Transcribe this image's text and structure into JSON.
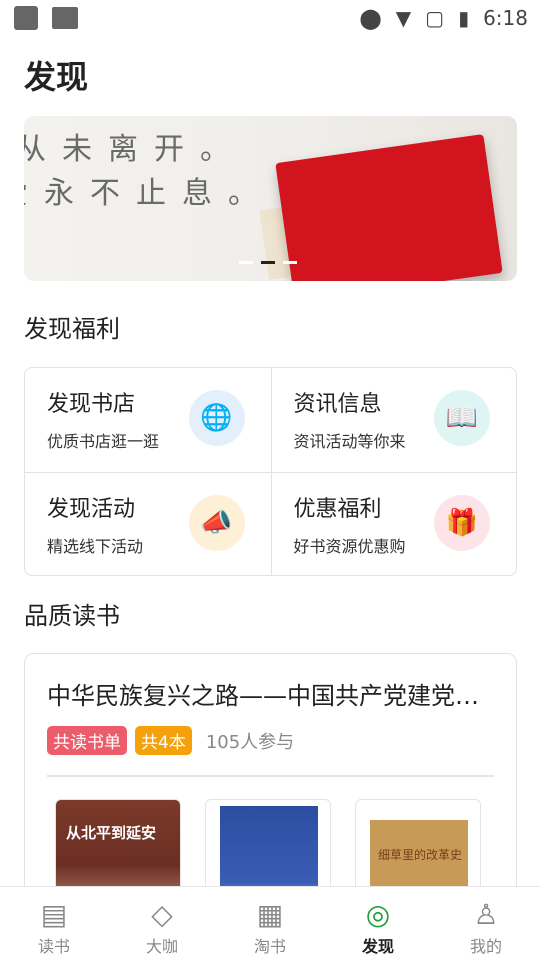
{
  "status_bar": {
    "time": "6:18"
  },
  "page": {
    "title": "发现"
  },
  "banner": {
    "line1": "从未离开。",
    "line2": "爱永不止息。"
  },
  "benefits": {
    "heading": "发现福利",
    "items": [
      {
        "title": "发现书店",
        "subtitle": "优质书店逛一逛",
        "icon": "globe-chat-icon",
        "color": "#4a90e2"
      },
      {
        "title": "资讯信息",
        "subtitle": "资讯活动等你来",
        "icon": "open-book-icon",
        "color": "#2bb5b0"
      },
      {
        "title": "发现活动",
        "subtitle": "精选线下活动",
        "icon": "megaphone-icon",
        "color": "#f5a623"
      },
      {
        "title": "优惠福利",
        "subtitle": "好书资源优惠购",
        "icon": "gift-icon",
        "color": "#f26d7d"
      }
    ]
  },
  "quality_reading": {
    "heading": "品质读书",
    "card": {
      "title": "中华民族复兴之路——中国共产党建党…",
      "tag1": "共读书单",
      "tag2": "共4本",
      "participants": "105人参与",
      "book1_title": "从北平到延安",
      "book3_title": "细草里的改革史"
    }
  },
  "bottom_nav": {
    "items": [
      {
        "label": "读书",
        "icon": "book-icon"
      },
      {
        "label": "大咖",
        "icon": "diamond-icon"
      },
      {
        "label": "淘书",
        "icon": "grid-icon"
      },
      {
        "label": "发现",
        "icon": "compass-icon",
        "active": true
      },
      {
        "label": "我的",
        "icon": "user-icon"
      }
    ]
  },
  "colors": {
    "accent_pink": "#ec5c6a",
    "accent_orange": "#f4a10b",
    "active_nav": "#222222"
  }
}
